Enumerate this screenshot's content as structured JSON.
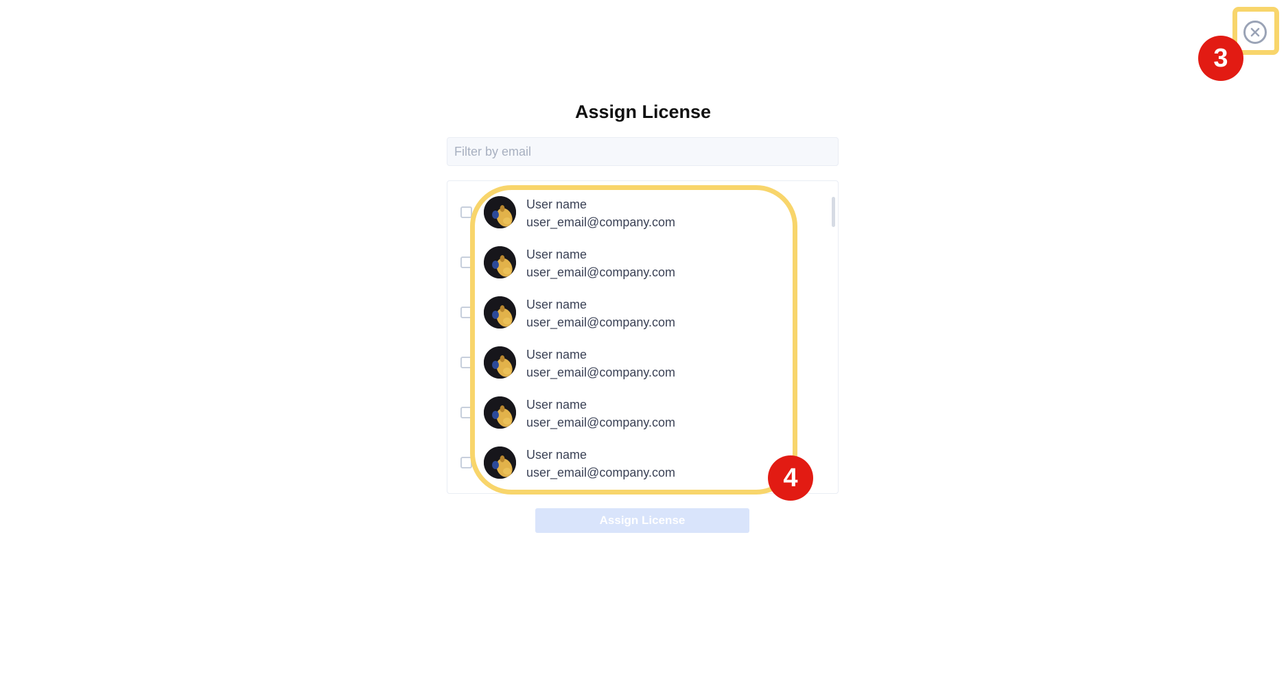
{
  "dialog": {
    "title": "Assign License",
    "filter": {
      "placeholder": "Filter by email",
      "value": ""
    },
    "users": [
      {
        "name": "User name",
        "email": "user_email@company.com",
        "checked": false
      },
      {
        "name": "User name",
        "email": "user_email@company.com",
        "checked": false
      },
      {
        "name": "User name",
        "email": "user_email@company.com",
        "checked": false
      },
      {
        "name": "User name",
        "email": "user_email@company.com",
        "checked": false
      },
      {
        "name": "User name",
        "email": "user_email@company.com",
        "checked": false
      },
      {
        "name": "User name",
        "email": "user_email@company.com",
        "checked": false
      }
    ],
    "assign_button_label": "Assign License",
    "assign_button_disabled": true,
    "close_icon": "close-circle-icon"
  },
  "annotations": {
    "close_marker": "3",
    "list_marker": "4",
    "highlight_color": "#f8d56b",
    "marker_color": "#e21b13"
  }
}
